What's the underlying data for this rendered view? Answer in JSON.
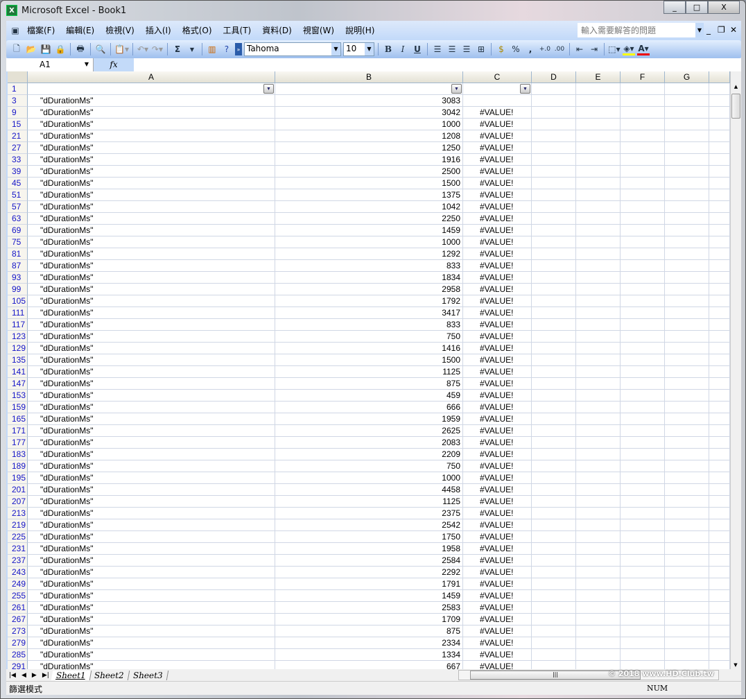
{
  "window": {
    "title": "Microsoft Excel - Book1",
    "minimize": "_",
    "maximize": "□",
    "close": "X"
  },
  "menu": {
    "items": [
      "檔案(F)",
      "編輯(E)",
      "檢視(V)",
      "插入(I)",
      "格式(O)",
      "工具(T)",
      "資料(D)",
      "視窗(W)",
      "說明(H)"
    ],
    "help_placeholder": "輸入需要解答的問題"
  },
  "toolbar": {
    "font": "Tahoma",
    "size": "10",
    "bold": "B",
    "italic": "I",
    "underline": "U",
    "percent": "%",
    "comma": ",",
    "sum": "Σ",
    "inc_decimal": "+.0",
    "dec_decimal": ".00"
  },
  "formula_bar": {
    "name_box": "A1",
    "fx": "fx",
    "formula": ""
  },
  "columns": [
    "A",
    "B",
    "C",
    "D",
    "E",
    "F",
    "G"
  ],
  "header_row": "1",
  "rows": {
    "numbers": [
      3,
      9,
      15,
      21,
      27,
      33,
      39,
      45,
      51,
      57,
      63,
      69,
      75,
      81,
      87,
      93,
      99,
      105,
      111,
      117,
      123,
      129,
      135,
      141,
      147,
      153,
      159,
      165,
      171,
      177,
      183,
      189,
      195,
      201,
      207,
      213,
      219,
      225,
      231,
      237,
      243,
      249,
      255,
      261,
      267,
      273,
      279,
      285,
      291
    ],
    "a_value": "\"dDurationMs\"",
    "b_values": [
      3083,
      3042,
      1000,
      1208,
      1250,
      1916,
      2500,
      1500,
      1375,
      1042,
      2250,
      1459,
      1000,
      1292,
      833,
      1834,
      2958,
      1792,
      3417,
      833,
      750,
      1416,
      1500,
      1125,
      875,
      459,
      666,
      1959,
      2625,
      2083,
      2209,
      750,
      1000,
      4458,
      1125,
      2375,
      2542,
      1750,
      1958,
      2584,
      2292,
      1791,
      1459,
      2583,
      1709,
      875,
      2334,
      1334,
      667
    ],
    "c_value": "#VALUE!",
    "c_first_empty": true
  },
  "sheets": {
    "tabs": [
      "Sheet1",
      "Sheet2",
      "Sheet3"
    ],
    "active": "Sheet1"
  },
  "status": {
    "mode": "篩選模式",
    "num": "NUM"
  },
  "watermark": "© 2018 www.HD.Club.tw",
  "colors": {
    "ui_blue": "#c3daf9",
    "row_header_text": "#1414c8",
    "grid": "#d0d7e5"
  }
}
